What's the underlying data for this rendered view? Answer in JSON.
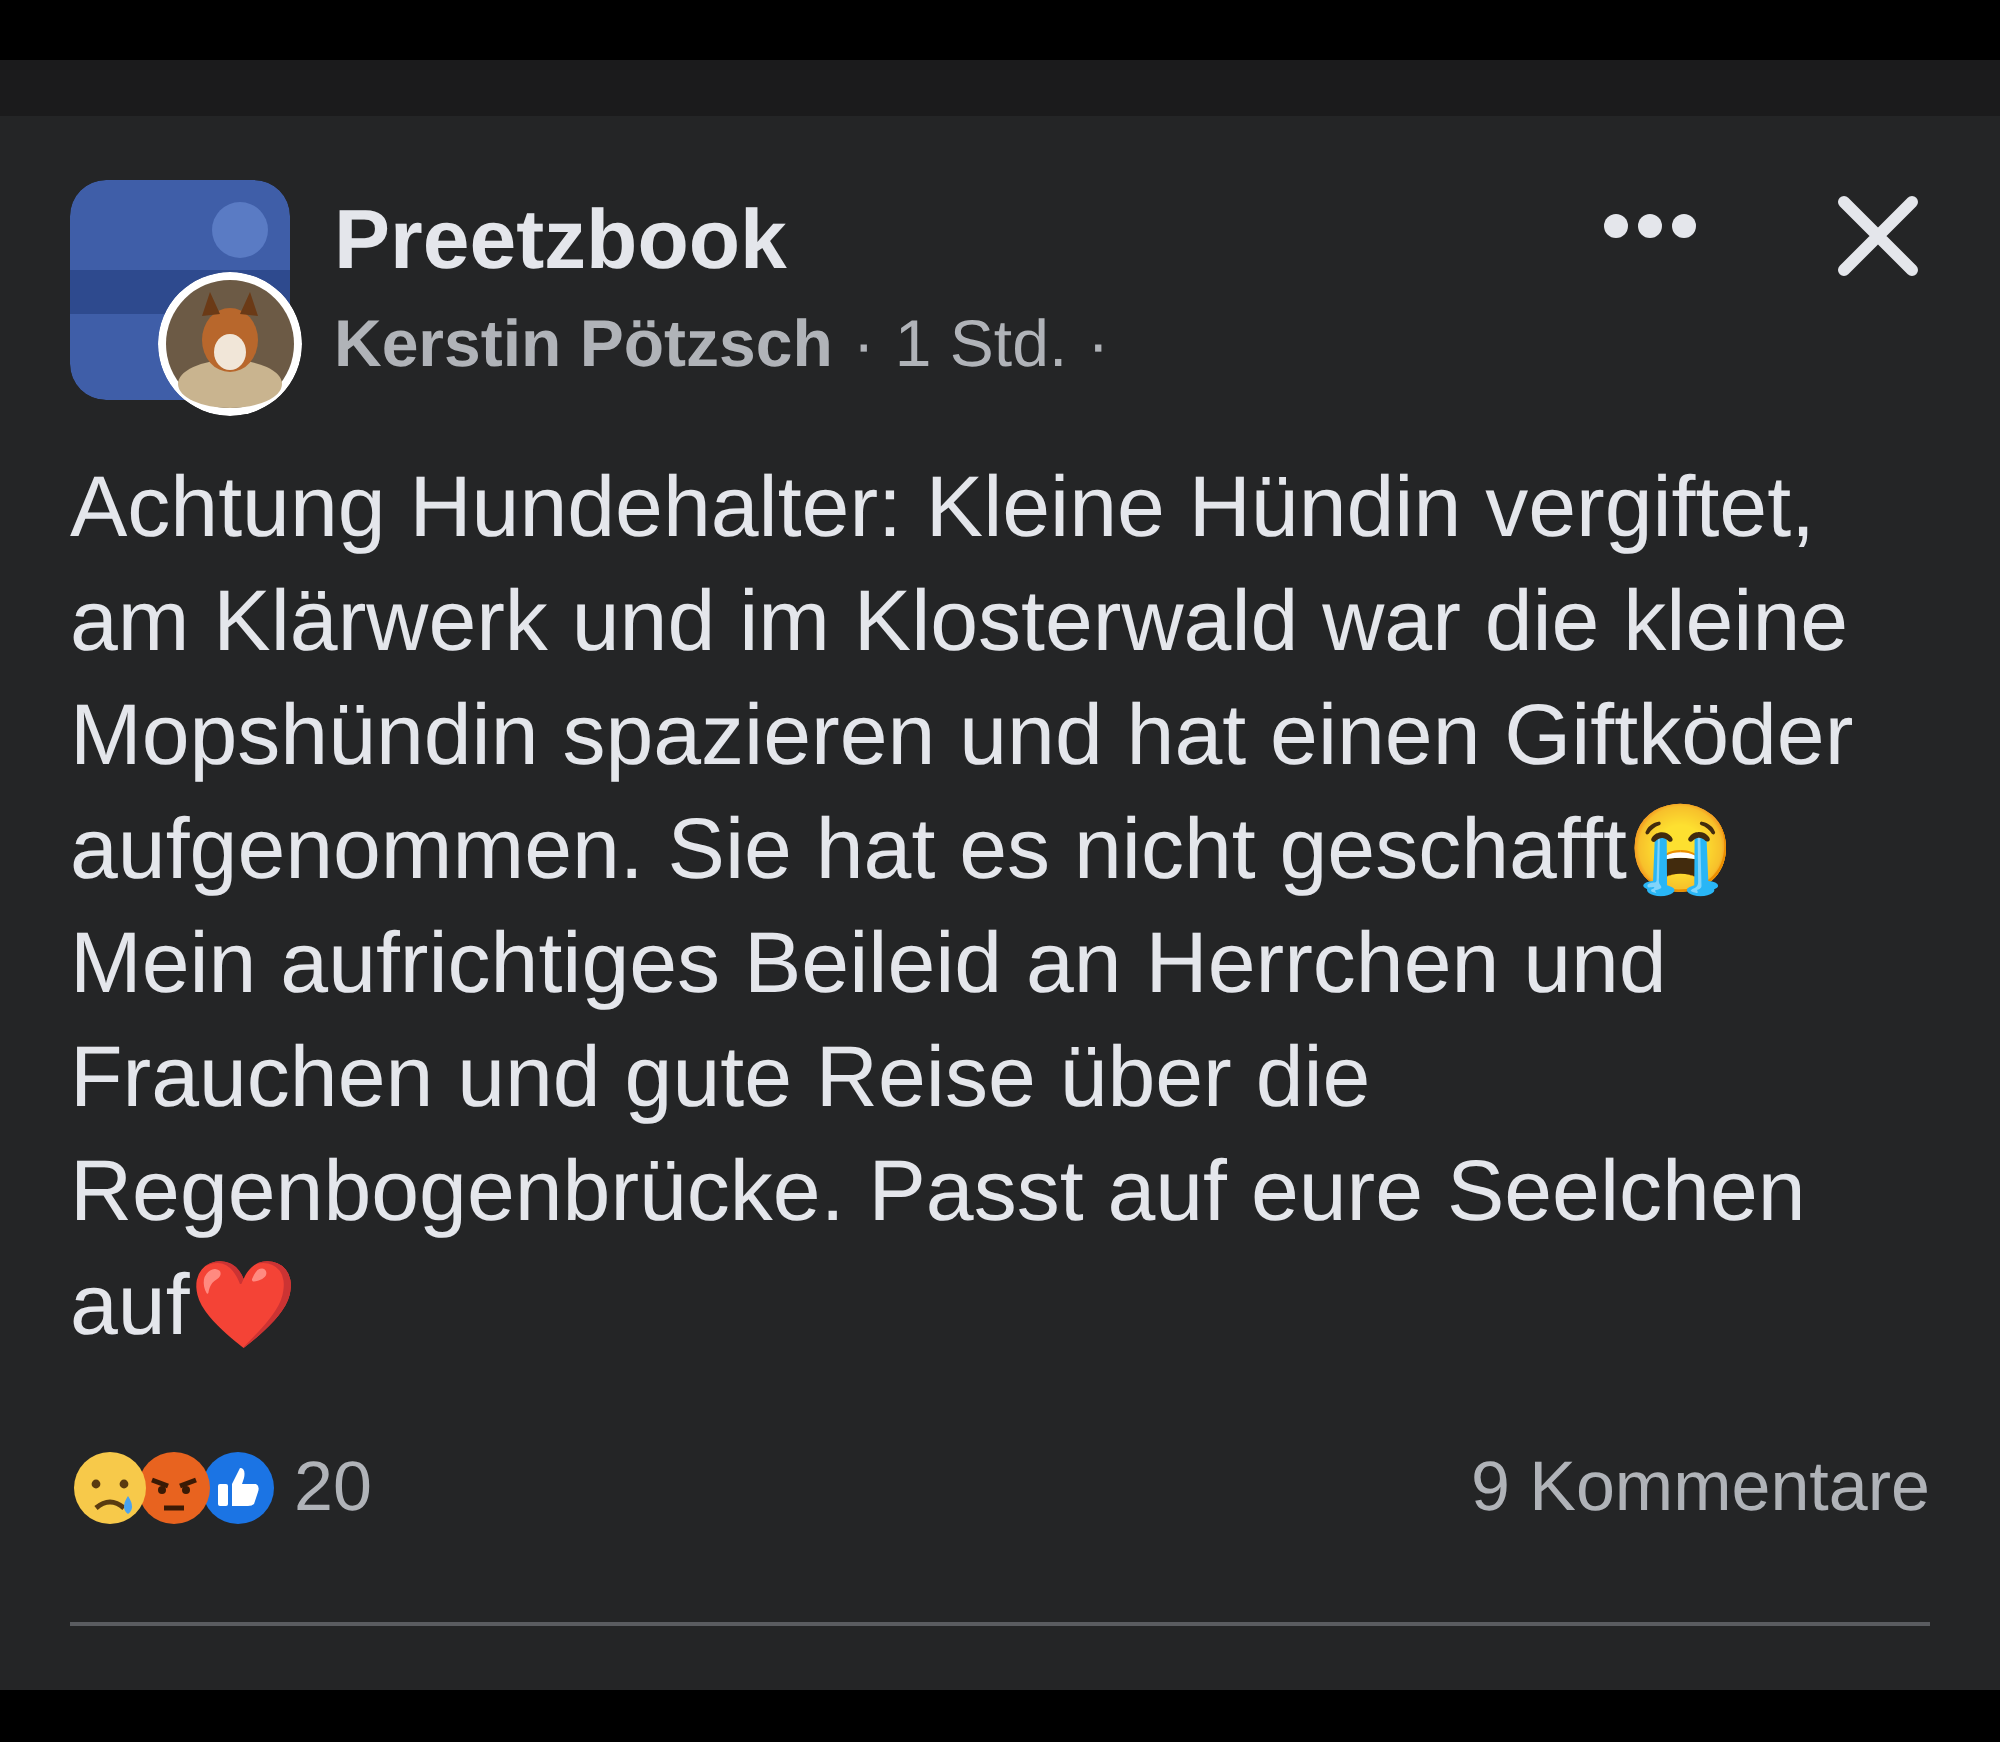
{
  "post": {
    "group_name": "Preetzbook",
    "author": "Kerstin Pötzsch",
    "time": "1 Std.",
    "separator_1": "·",
    "separator_2": "·",
    "body": "Achtung Hundehalter: Kleine Hündin vergiftet, am Klärwerk und im Klosterwald war die kleine Mopshündin spazieren und hat einen Giftköder aufgenommen. Sie hat es nicht geschafft😭 Mein aufrichtiges Beileid an Herrchen und Frauchen und gute Reise über die Regenbogenbrücke. Passt auf eure Seelchen auf❤️",
    "reactions": [
      {
        "kind": "sad"
      },
      {
        "kind": "angry"
      },
      {
        "kind": "like"
      }
    ],
    "reaction_count": "20",
    "comments": "9 Kommentare"
  }
}
